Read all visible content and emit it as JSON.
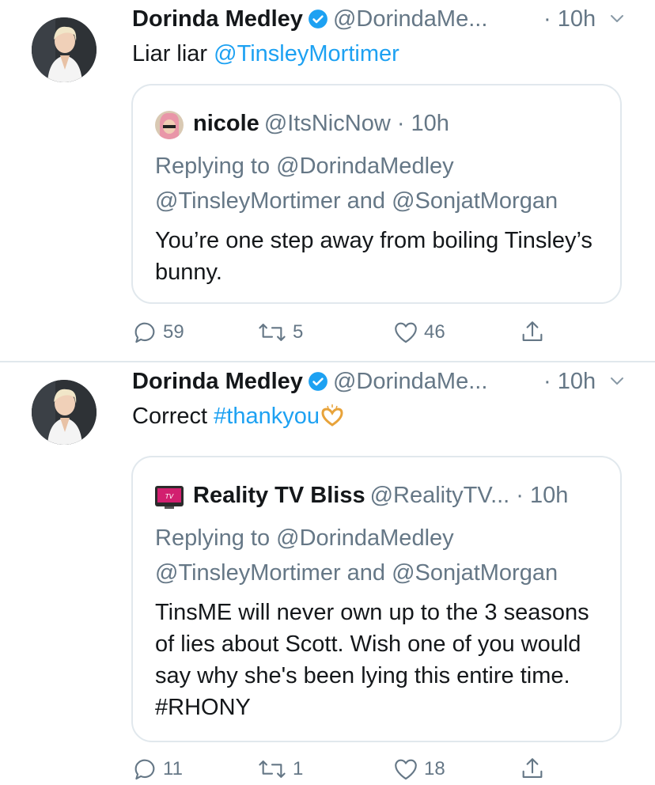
{
  "tweets": [
    {
      "author": {
        "name": "Dorinda Medley",
        "handle": "@DorindaMe...",
        "time": "· 10h"
      },
      "text_plain": "Liar liar ",
      "text_link": "@TinsleyMortimer",
      "quote": {
        "name": "nicole",
        "handle": "@ItsNicNow · 10h",
        "replying_label": "Replying to ",
        "replying_to_1": "@DorindaMedley",
        "replying_to_2": "@TinsleyMortimer",
        "replying_and": " and ",
        "replying_to_3": "@SonjatMorgan",
        "text": "You’re one step away from boiling Tinsley’s bunny."
      },
      "actions": {
        "replies": "59",
        "retweets": "5",
        "likes": "46"
      }
    },
    {
      "author": {
        "name": "Dorinda Medley",
        "handle": "@DorindaMe...",
        "time": "· 10h"
      },
      "text_plain": "Correct ",
      "text_link": "#thankyou",
      "quote": {
        "name": "Reality TV Bliss",
        "handle": "@RealityTV... · 10h",
        "replying_label": "Replying to ",
        "replying_to_1": "@DorindaMedley",
        "replying_to_2": "@TinsleyMortimer",
        "replying_and": " and ",
        "replying_to_3": "@SonjatMorgan",
        "text": "TinsME will never own up to the 3 seasons of lies about Scott.  Wish one of you would say why she's been lying this entire time. #RHONY"
      },
      "actions": {
        "replies": "11",
        "retweets": "1",
        "likes": "18"
      }
    }
  ],
  "colors": {
    "link": "#1da1f2",
    "muted": "#657786",
    "border": "#e1e8ed"
  },
  "icons": [
    "verified-badge-icon",
    "chevron-down-icon",
    "reply-icon",
    "retweet-icon",
    "like-icon",
    "share-icon"
  ]
}
